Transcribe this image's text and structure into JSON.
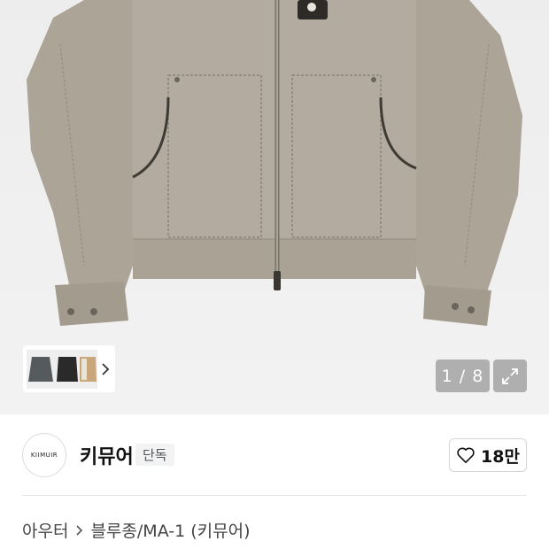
{
  "gallery": {
    "counter_current": "1",
    "counter_total": "8",
    "counter_sep": " / ",
    "accent_bg": "#efefef"
  },
  "icons": {
    "thumb_next": "chevron-right-icon",
    "expand": "expand-icon",
    "like": "heart-icon",
    "breadcrumb_sep": "chevron-right-icon"
  },
  "brand": {
    "logo_text": "KIIMUIR",
    "name": "키뮤어",
    "badge": "단독"
  },
  "like": {
    "count": "18만"
  },
  "breadcrumb": {
    "items": [
      "아우터",
      "블루종/MA-1 (키뮤어)"
    ]
  }
}
